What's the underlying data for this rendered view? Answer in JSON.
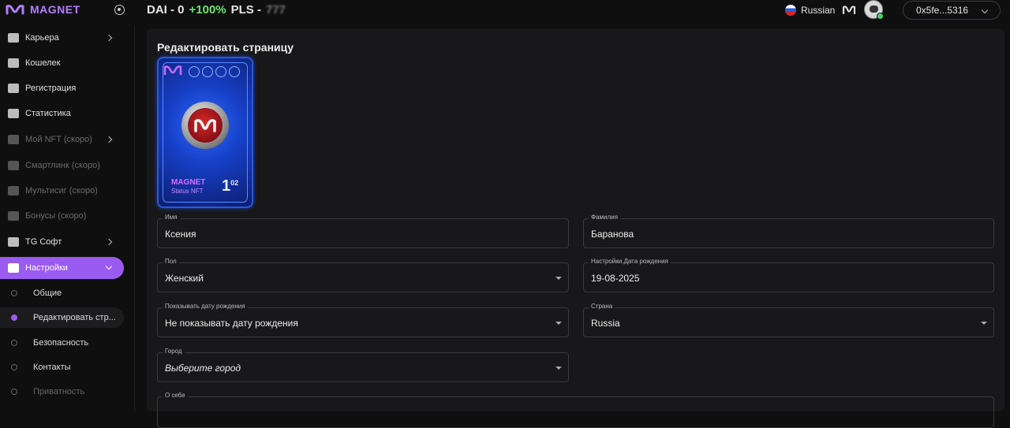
{
  "header": {
    "brand": "MAGNET",
    "dai_label": "DAI - 0",
    "dai_change": "+100%",
    "pls_label": "PLS -",
    "pls_value": "777",
    "language": "Russian",
    "wallet": "0x5fe...5316"
  },
  "sidebar": {
    "items": [
      {
        "label": "Карьера",
        "icon": "hand-icon"
      },
      {
        "label": "Кошелек",
        "icon": "wallet-icon"
      },
      {
        "label": "Регистрация",
        "icon": "user-add-icon"
      },
      {
        "label": "Статистика",
        "icon": "bar-chart-icon"
      },
      {
        "label": "Мой NFT (скоро)",
        "icon": "nft-icon"
      },
      {
        "label": "Смартлинк (скоро)",
        "icon": "glasses-icon"
      },
      {
        "label": "Мультисиг (скоро)",
        "icon": "shield-icon"
      },
      {
        "label": "Бонусы (скоро)",
        "icon": "bonus-icon"
      },
      {
        "label": "TG Софт",
        "icon": "telegram-icon"
      },
      {
        "label": "Настройки",
        "icon": "gear-icon"
      }
    ],
    "settings_sub": [
      {
        "label": "Общие"
      },
      {
        "label": "Редактировать стр..."
      },
      {
        "label": "Безопасность"
      },
      {
        "label": "Контакты"
      },
      {
        "label": "Приватность"
      }
    ]
  },
  "main": {
    "title": "Редактировать страницу",
    "nft": {
      "name": "MAGNET",
      "sub": "Status NFT",
      "number": "1",
      "sup": "02"
    },
    "fields": {
      "first_name": {
        "label": "Имя",
        "value": "Ксения"
      },
      "last_name": {
        "label": "Фамилия",
        "value": "Баранова"
      },
      "gender": {
        "label": "Пол",
        "value": "Женский"
      },
      "birthdate": {
        "label": "Настройки.Дата рождения",
        "value": "19-08-2025"
      },
      "show_birthdate": {
        "label": "Показывать дату рождения",
        "value": "Не показывать дату рождения"
      },
      "country": {
        "label": "Страна",
        "value": "Russia"
      },
      "city": {
        "label": "Город",
        "value": "Выберите город"
      },
      "about": {
        "label": "О себе",
        "value": ""
      }
    }
  }
}
